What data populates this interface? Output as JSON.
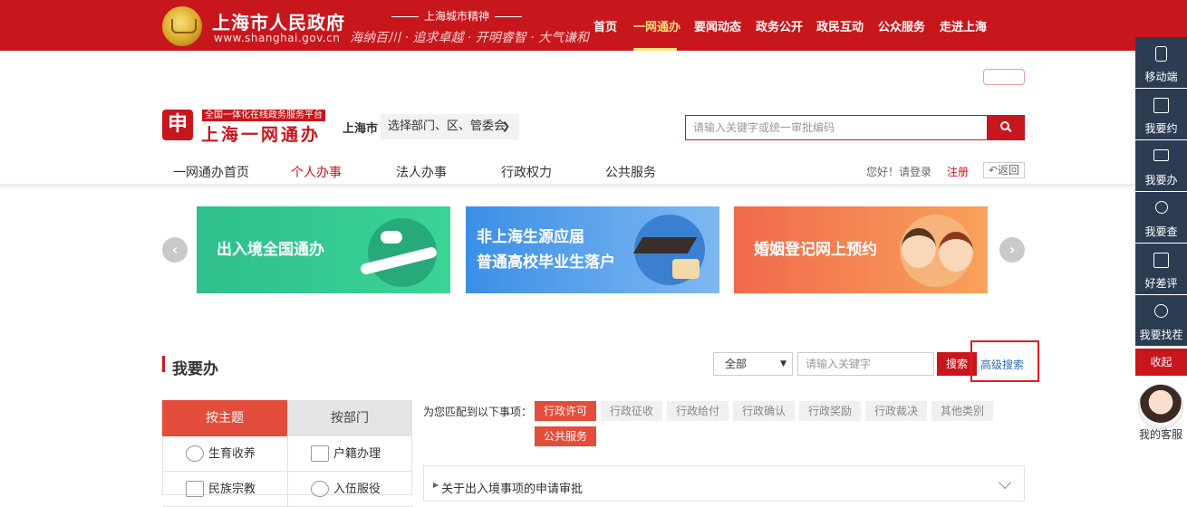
{
  "topbar": {
    "site_title": "上海市人民政府",
    "site_url": "www.shanghai.gov.cn",
    "spirit_heading": "上海城市精神",
    "spirit_text": "海纳百川 · 追求卓越 · 开明睿智 · 大气谦和",
    "nav": [
      "首页",
      "一网通办",
      "要闻动态",
      "政务公开",
      "政民互动",
      "公众服务",
      "走进上海"
    ],
    "active_nav": "一网通办",
    "accent_color": "#c8161d"
  },
  "portal": {
    "logo_char": "申",
    "subtitle": "全国一体化在线政务服务平台",
    "title": "上海一网通办",
    "city": "上海市",
    "dept_select": "选择部门、区、管委会",
    "search_placeholder": "请输入关键字或统一审批编码"
  },
  "subnav": {
    "items": [
      "一网通办首页",
      "个人办事",
      "法人办事",
      "行政权力",
      "公共服务"
    ],
    "active": "个人办事",
    "greeting": "您好！请登录",
    "register": "注册",
    "back": "返回"
  },
  "banners": [
    {
      "text": "出入境全国通办"
    },
    {
      "text_line1": "非上海生源应届",
      "text_line2": "普通高校毕业生落户"
    },
    {
      "text": "婚姻登记网上预约"
    }
  ],
  "section": {
    "title": "我要办",
    "category_select": "全部",
    "keyword_placeholder": "请输入关键字",
    "search_button": "搜索",
    "advanced_search": "高级搜索"
  },
  "tabs": {
    "by_theme": "按主题",
    "by_dept": "按部门"
  },
  "themes": [
    {
      "label": "生育收养",
      "icon": "baby-icon"
    },
    {
      "label": "户籍办理",
      "icon": "id-card-icon"
    },
    {
      "label": "民族宗教",
      "icon": "temple-icon"
    },
    {
      "label": "入伍服役",
      "icon": "military-cap-icon"
    }
  ],
  "matching": {
    "label": "为您匹配到以下事项：",
    "tags": [
      {
        "label": "行政许可",
        "active": true
      },
      {
        "label": "行政征收",
        "active": false
      },
      {
        "label": "行政给付",
        "active": false
      },
      {
        "label": "行政确认",
        "active": false
      },
      {
        "label": "行政奖励",
        "active": false
      },
      {
        "label": "行政裁决",
        "active": false
      },
      {
        "label": "其他类别",
        "active": false
      },
      {
        "label": "公共服务",
        "active": true
      }
    ],
    "first_item": "关于出入境事项的申请审批"
  },
  "sidebar": {
    "items": [
      "移动端",
      "我要约",
      "我要办",
      "我要查",
      "好差评",
      "我要找茬"
    ],
    "collapse": "收起",
    "customer_service": "我的客服"
  }
}
